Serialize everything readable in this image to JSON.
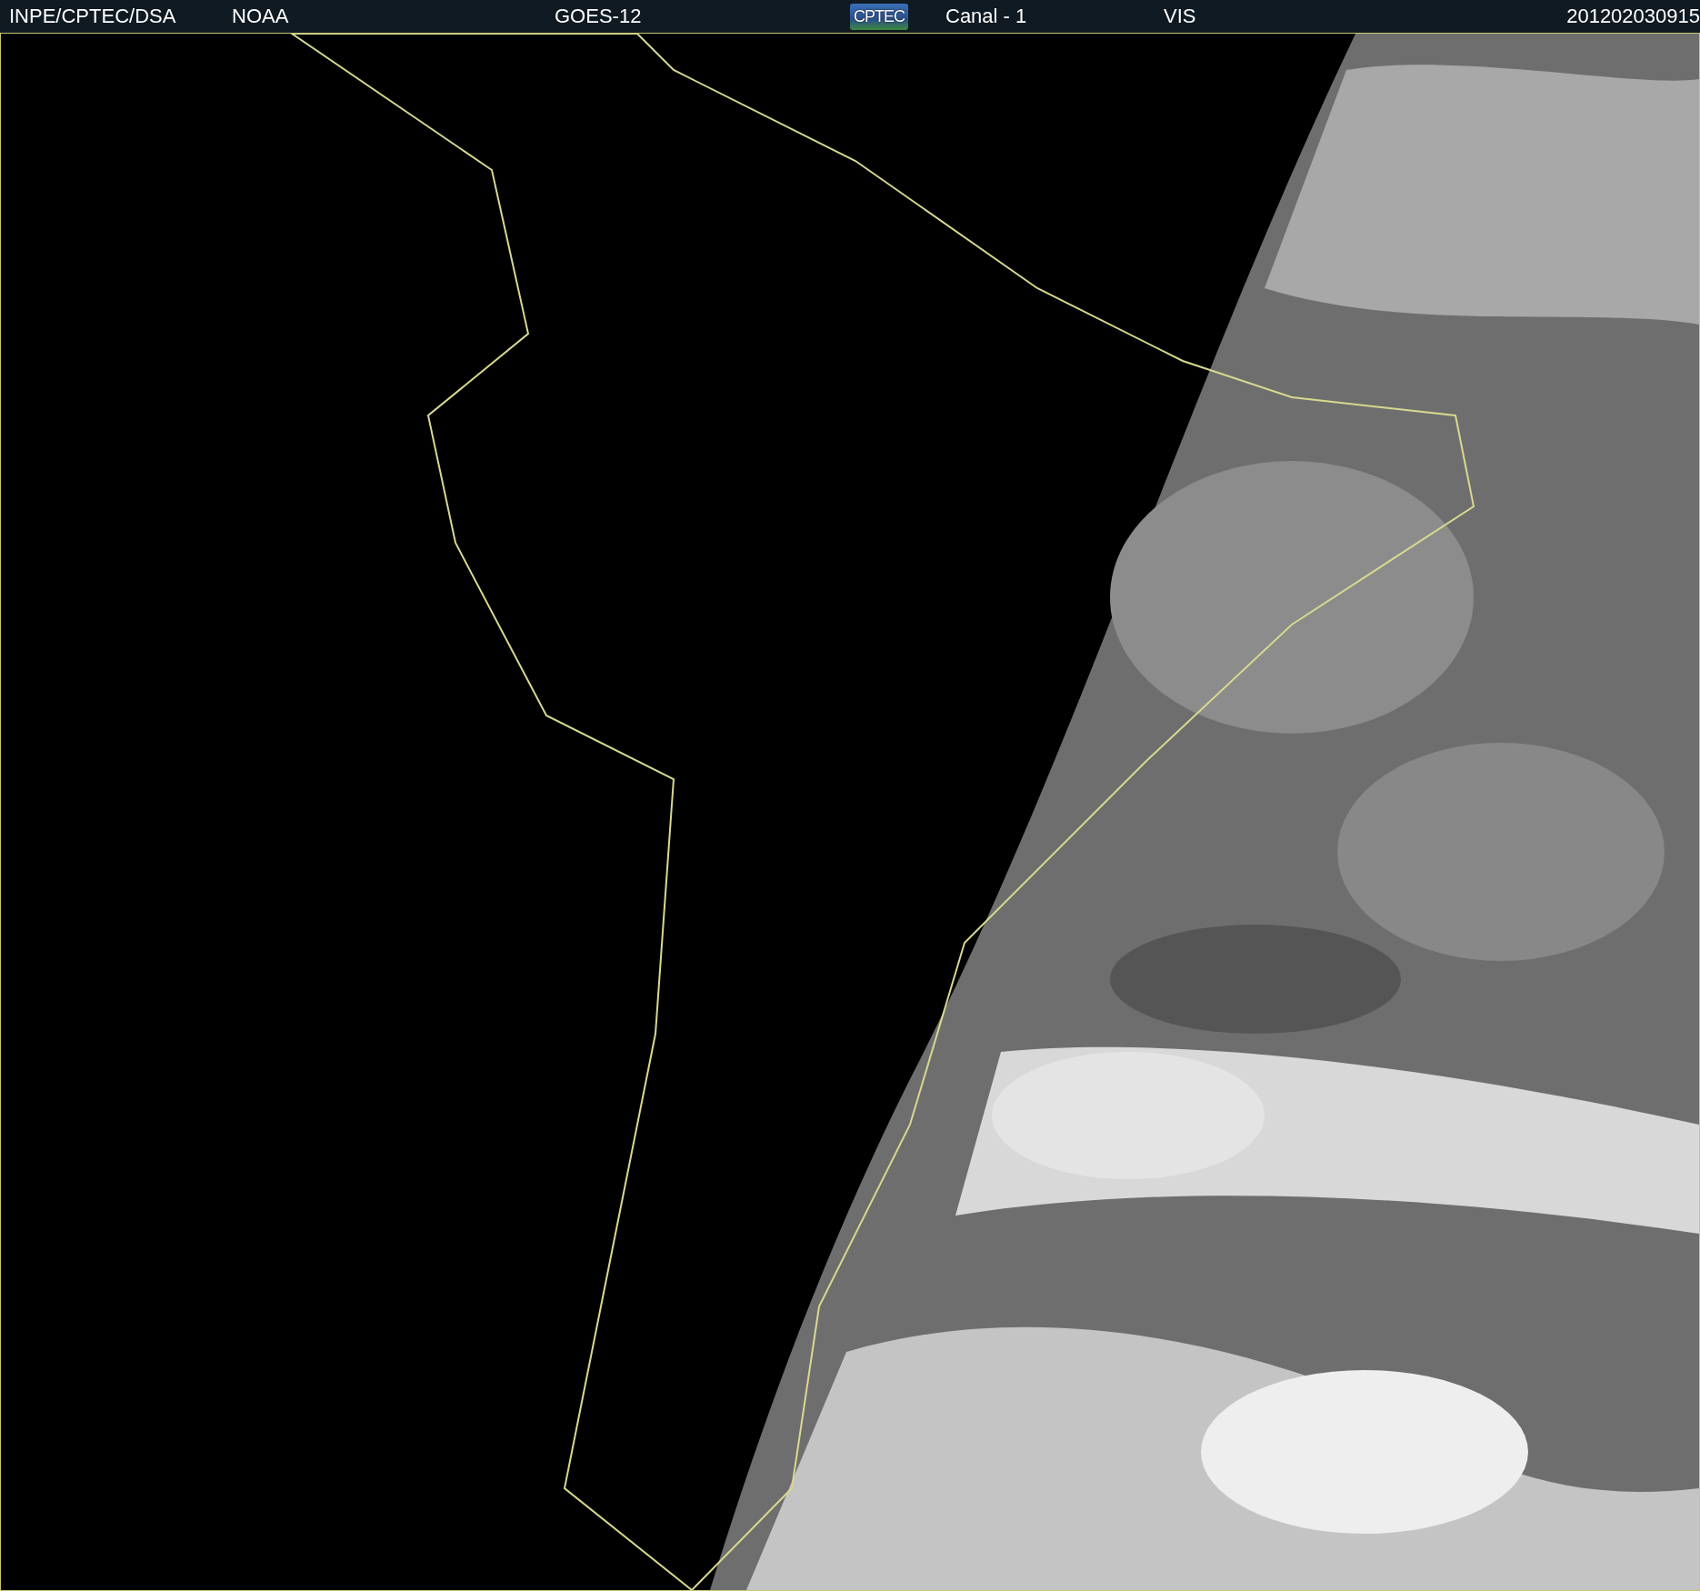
{
  "header": {
    "items": [
      {
        "kind": "text",
        "text": "INPE/CPTEC/DSA"
      },
      {
        "kind": "text",
        "text": "NOAA"
      },
      {
        "kind": "text",
        "text": "GOES-12"
      },
      {
        "kind": "logo",
        "text": "CPTEC"
      },
      {
        "kind": "text",
        "text": "Canal - 1"
      },
      {
        "kind": "text",
        "text": "VIS"
      },
      {
        "kind": "text",
        "text": "201202030915"
      }
    ]
  }
}
